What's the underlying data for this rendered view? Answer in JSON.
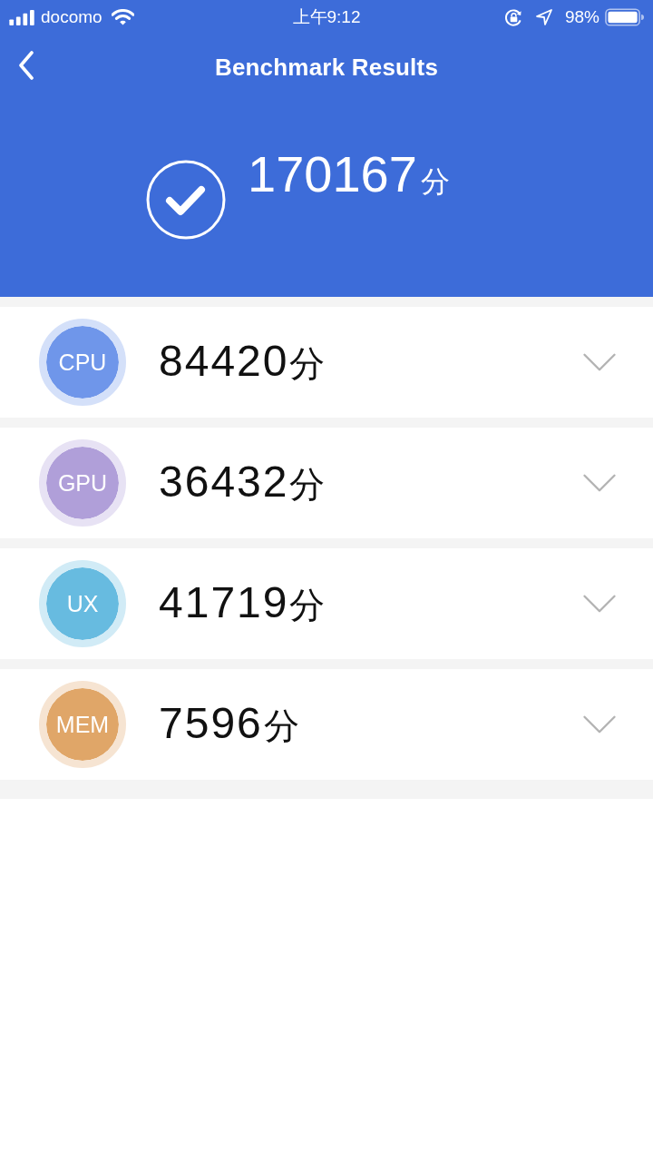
{
  "status_bar": {
    "carrier": "docomo",
    "time": "上午9:12",
    "battery": "98%"
  },
  "nav_bar": {
    "title": "Benchmark Results"
  },
  "summary": {
    "score": "170167",
    "unit": "分"
  },
  "results": [
    {
      "label": "CPU",
      "score": "84420",
      "unit": "分",
      "color": "#6f96ea",
      "expanded": false
    },
    {
      "label": "GPU",
      "score": "36432",
      "unit": "分",
      "color": "#b09fd9",
      "expanded": false
    },
    {
      "label": "UX",
      "score": "41719",
      "unit": "分",
      "color": "#67bbe0",
      "expanded": false
    },
    {
      "label": "MEM",
      "score": "7596",
      "unit": "分",
      "color": "#e0a668",
      "expanded": false
    }
  ]
}
